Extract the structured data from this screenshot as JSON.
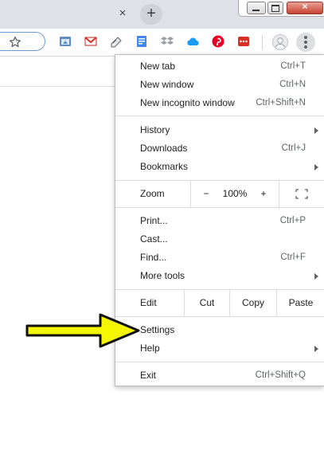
{
  "window": {
    "close_glyph": "×",
    "new_tab_glyph": "+",
    "win_close_glyph": "×"
  },
  "toolbar": {
    "icons": [
      "star-icon",
      "gmail-extension-icon",
      "todo-extension-icon",
      "docs-extension-icon",
      "dropbox-icon",
      "cloud-icon",
      "pinterest-icon",
      "more-extension-icon"
    ]
  },
  "menu": {
    "new_tab": {
      "label": "New tab",
      "shortcut": "Ctrl+T"
    },
    "new_window": {
      "label": "New window",
      "shortcut": "Ctrl+N"
    },
    "new_incognito": {
      "label": "New incognito window",
      "shortcut": "Ctrl+Shift+N"
    },
    "history": {
      "label": "History"
    },
    "downloads": {
      "label": "Downloads",
      "shortcut": "Ctrl+J"
    },
    "bookmarks": {
      "label": "Bookmarks"
    },
    "zoom": {
      "label": "Zoom",
      "minus": "−",
      "value": "100%",
      "plus": "+"
    },
    "print": {
      "label": "Print...",
      "shortcut": "Ctrl+P"
    },
    "cast": {
      "label": "Cast..."
    },
    "find": {
      "label": "Find...",
      "shortcut": "Ctrl+F"
    },
    "more_tools": {
      "label": "More tools"
    },
    "edit": {
      "label": "Edit",
      "cut": "Cut",
      "copy": "Copy",
      "paste": "Paste"
    },
    "settings": {
      "label": "Settings"
    },
    "help": {
      "label": "Help"
    },
    "exit": {
      "label": "Exit",
      "shortcut": "Ctrl+Shift+Q"
    }
  },
  "colors": {
    "accent_arrow": "#f4f700",
    "close_red": "#c7432f",
    "focus_blue": "#6e9ad8"
  }
}
